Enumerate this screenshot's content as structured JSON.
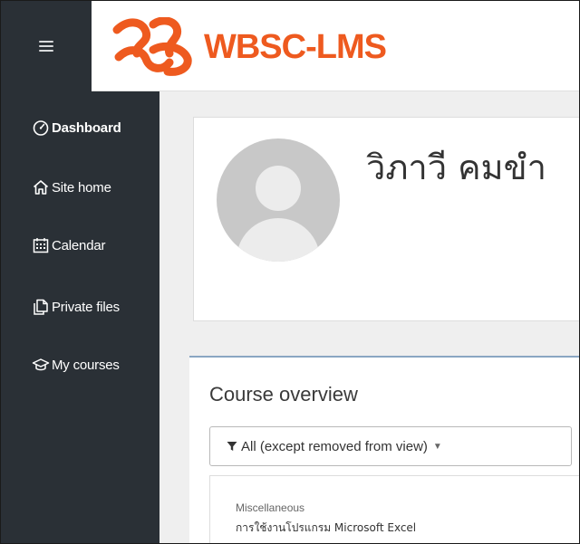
{
  "brand": {
    "name": "WBSC-LMS",
    "color": "#ee5a1f"
  },
  "sidebar": {
    "items": [
      {
        "label": "Dashboard",
        "icon": "dashboard-icon",
        "active": true
      },
      {
        "label": "Site home",
        "icon": "home-icon"
      },
      {
        "label": "Calendar",
        "icon": "calendar-icon"
      },
      {
        "label": "Private files",
        "icon": "files-icon"
      },
      {
        "label": "My courses",
        "icon": "graduation-cap-icon"
      }
    ]
  },
  "profile": {
    "name": "วิภาวี คมขำ"
  },
  "course_overview": {
    "title": "Course overview",
    "filter_label": "All (except removed from view)",
    "courses": [
      {
        "category": "Miscellaneous",
        "name": "การใช้งานโปรแกรม Microsoft Excel"
      }
    ]
  }
}
